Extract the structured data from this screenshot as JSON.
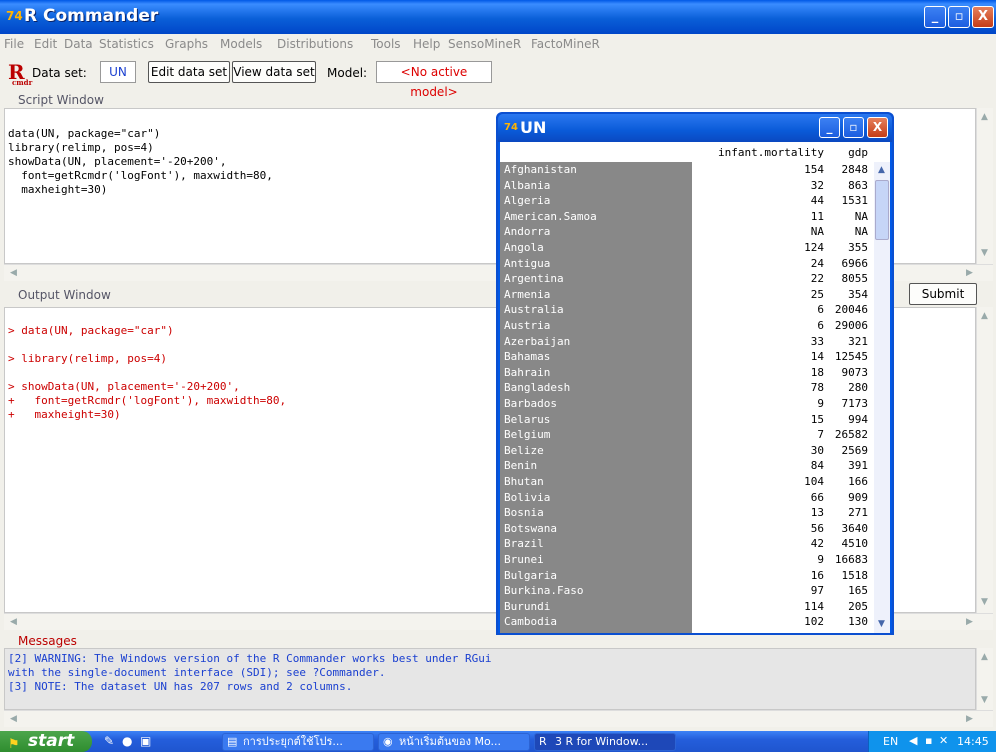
{
  "window": {
    "title": "R Commander",
    "icon": "R-commander-icon",
    "btn_min": "_",
    "btn_max": "▫",
    "btn_close": "X"
  },
  "menu": [
    "File",
    "Edit",
    "Data",
    "Statistics",
    "Graphs",
    "Models",
    "Distributions",
    "Tools",
    "Help",
    "SensoMineR",
    "FactoMineR"
  ],
  "toolbar": {
    "logo": "R",
    "logo_sub": "cmdr",
    "dataset_label": "Data set:",
    "dataset_value": "UN",
    "edit_btn": "Edit data set",
    "view_btn": "View data set",
    "model_label": "Model:",
    "model_value": "<No active model>"
  },
  "script": {
    "label": "Script Window",
    "lines": [
      "data(UN, package=\"car\")",
      "library(relimp, pos=4)",
      "showData(UN, placement='-20+200',",
      "  font=getRcmdr('logFont'), maxwidth=80,",
      "  maxheight=30)"
    ]
  },
  "submit_label": "Submit",
  "output": {
    "label": "Output Window",
    "lines": [
      "> data(UN, package=\"car\")",
      "",
      "> library(relimp, pos=4)",
      "",
      "> showData(UN, placement='-20+200',",
      "+   font=getRcmdr('logFont'), maxwidth=80,",
      "+   maxheight=30)"
    ]
  },
  "messages": {
    "label": "Messages",
    "lines": [
      "[2] WARNING: The Windows version of the R Commander works best under RGui",
      "with the single-document interface (SDI); see ?Commander.",
      "[3] NOTE: The dataset UN has 207 rows and 2 columns."
    ]
  },
  "un_window": {
    "title": "UN",
    "headers": [
      "infant.mortality",
      "gdp"
    ],
    "rows": [
      [
        "Afghanistan",
        "154",
        "2848"
      ],
      [
        "Albania",
        "32",
        "863"
      ],
      [
        "Algeria",
        "44",
        "1531"
      ],
      [
        "American.Samoa",
        "11",
        "NA"
      ],
      [
        "Andorra",
        "NA",
        "NA"
      ],
      [
        "Angola",
        "124",
        "355"
      ],
      [
        "Antigua",
        "24",
        "6966"
      ],
      [
        "Argentina",
        "22",
        "8055"
      ],
      [
        "Armenia",
        "25",
        "354"
      ],
      [
        "Australia",
        "6",
        "20046"
      ],
      [
        "Austria",
        "6",
        "29006"
      ],
      [
        "Azerbaijan",
        "33",
        "321"
      ],
      [
        "Bahamas",
        "14",
        "12545"
      ],
      [
        "Bahrain",
        "18",
        "9073"
      ],
      [
        "Bangladesh",
        "78",
        "280"
      ],
      [
        "Barbados",
        "9",
        "7173"
      ],
      [
        "Belarus",
        "15",
        "994"
      ],
      [
        "Belgium",
        "7",
        "26582"
      ],
      [
        "Belize",
        "30",
        "2569"
      ],
      [
        "Benin",
        "84",
        "391"
      ],
      [
        "Bhutan",
        "104",
        "166"
      ],
      [
        "Bolivia",
        "66",
        "909"
      ],
      [
        "Bosnia",
        "13",
        "271"
      ],
      [
        "Botswana",
        "56",
        "3640"
      ],
      [
        "Brazil",
        "42",
        "4510"
      ],
      [
        "Brunei",
        "9",
        "16683"
      ],
      [
        "Bulgaria",
        "16",
        "1518"
      ],
      [
        "Burkina.Faso",
        "97",
        "165"
      ],
      [
        "Burundi",
        "114",
        "205"
      ],
      [
        "Cambodia",
        "102",
        "130"
      ]
    ]
  },
  "taskbar": {
    "start": "start",
    "tasks": [
      "การประยุกต์ใช้โปร...",
      "หน้าเริ่มต้นของ Mo...",
      "3 R for Window..."
    ],
    "lang": "EN",
    "time": "14:45"
  }
}
